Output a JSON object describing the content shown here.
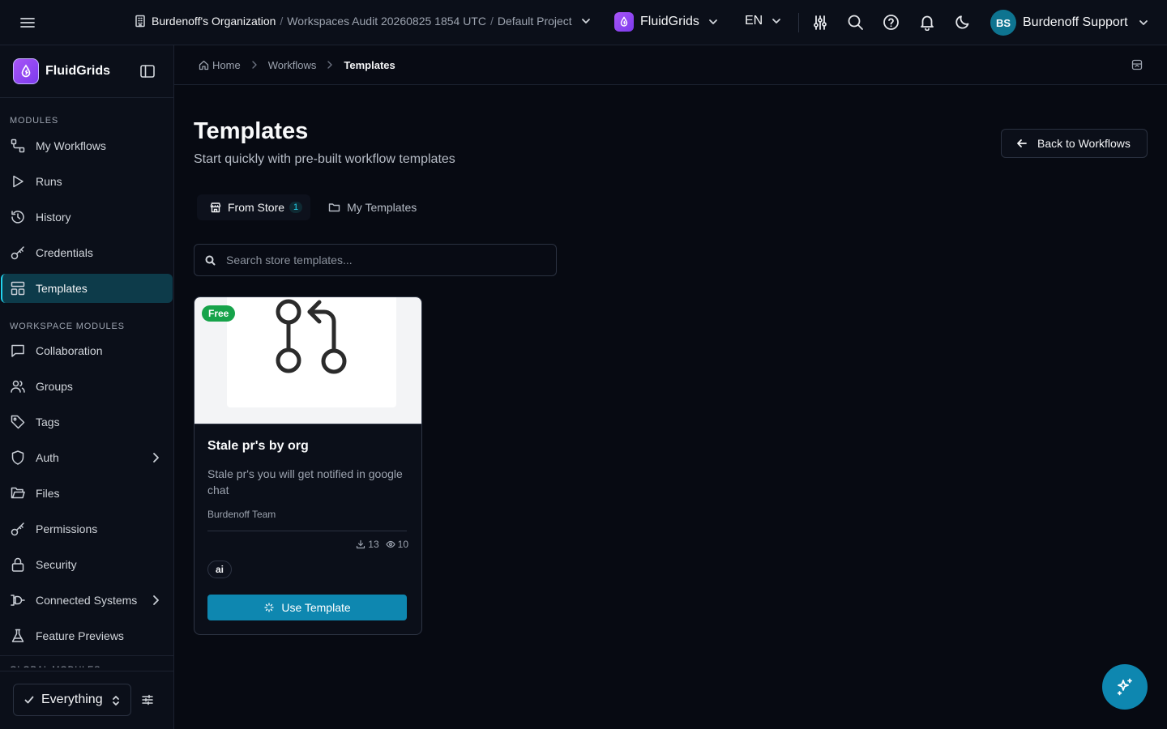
{
  "topbar": {
    "org_name": "Burdenoff's Organization",
    "workspace": "Workspaces Audit 20260825 1854 UTC",
    "project": "Default Project",
    "separator": "/",
    "app_name": "FluidGrids",
    "language": "EN",
    "user_initials": "BS",
    "user_name": "Burdenoff Support",
    "icons": [
      "menu-icon",
      "building-icon",
      "sliders-icon",
      "search-icon",
      "help-icon",
      "bell-icon",
      "moon-icon"
    ]
  },
  "sidebar": {
    "app_title": "FluidGrids",
    "sections": {
      "modules": "MODULES",
      "workspace_modules": "WORKSPACE MODULES",
      "global_modules": "GLOBAL MODULES"
    },
    "modules": [
      {
        "label": "My Workflows",
        "icon": "workflow-icon"
      },
      {
        "label": "Runs",
        "icon": "play-icon"
      },
      {
        "label": "History",
        "icon": "history-icon"
      },
      {
        "label": "Credentials",
        "icon": "key-icon"
      },
      {
        "label": "Templates",
        "icon": "templates-icon",
        "active": true
      }
    ],
    "workspace_modules": [
      {
        "label": "Collaboration",
        "icon": "chat-icon"
      },
      {
        "label": "Groups",
        "icon": "users-icon"
      },
      {
        "label": "Tags",
        "icon": "tag-icon"
      },
      {
        "label": "Auth",
        "icon": "shield-icon",
        "expandable": true
      },
      {
        "label": "Files",
        "icon": "folder-icon"
      },
      {
        "label": "Permissions",
        "icon": "key-icon"
      },
      {
        "label": "Security",
        "icon": "lock-icon"
      },
      {
        "label": "Connected Systems",
        "icon": "plug-icon",
        "expandable": true
      },
      {
        "label": "Feature Previews",
        "icon": "flask-icon"
      }
    ],
    "scope_selector": "Everything"
  },
  "breadcrumb": {
    "home": "Home",
    "workflows": "Workflows",
    "current": "Templates"
  },
  "page": {
    "title": "Templates",
    "subtitle": "Start quickly with pre-built workflow templates",
    "back_button": "Back to Workflows"
  },
  "tabs": [
    {
      "label": "From Store",
      "count": "1",
      "active": true
    },
    {
      "label": "My Templates"
    }
  ],
  "search": {
    "placeholder": "Search store templates...",
    "value": ""
  },
  "templates": [
    {
      "badge": "Free",
      "title": "Stale pr's by org",
      "description": "Stale pr's you will get notified in google chat",
      "author": "Burdenoff Team",
      "downloads": "13",
      "views": "10",
      "tags": [
        "ai"
      ],
      "action": "Use Template",
      "image_icon": "git-pull-request-icon"
    }
  ],
  "colors": {
    "background": "#070a12",
    "panel": "#0b0f19",
    "accent": "#0e87b0",
    "active_nav": "#0d3b4a",
    "brand": "#a855f7",
    "badge_green": "#16a34a"
  }
}
